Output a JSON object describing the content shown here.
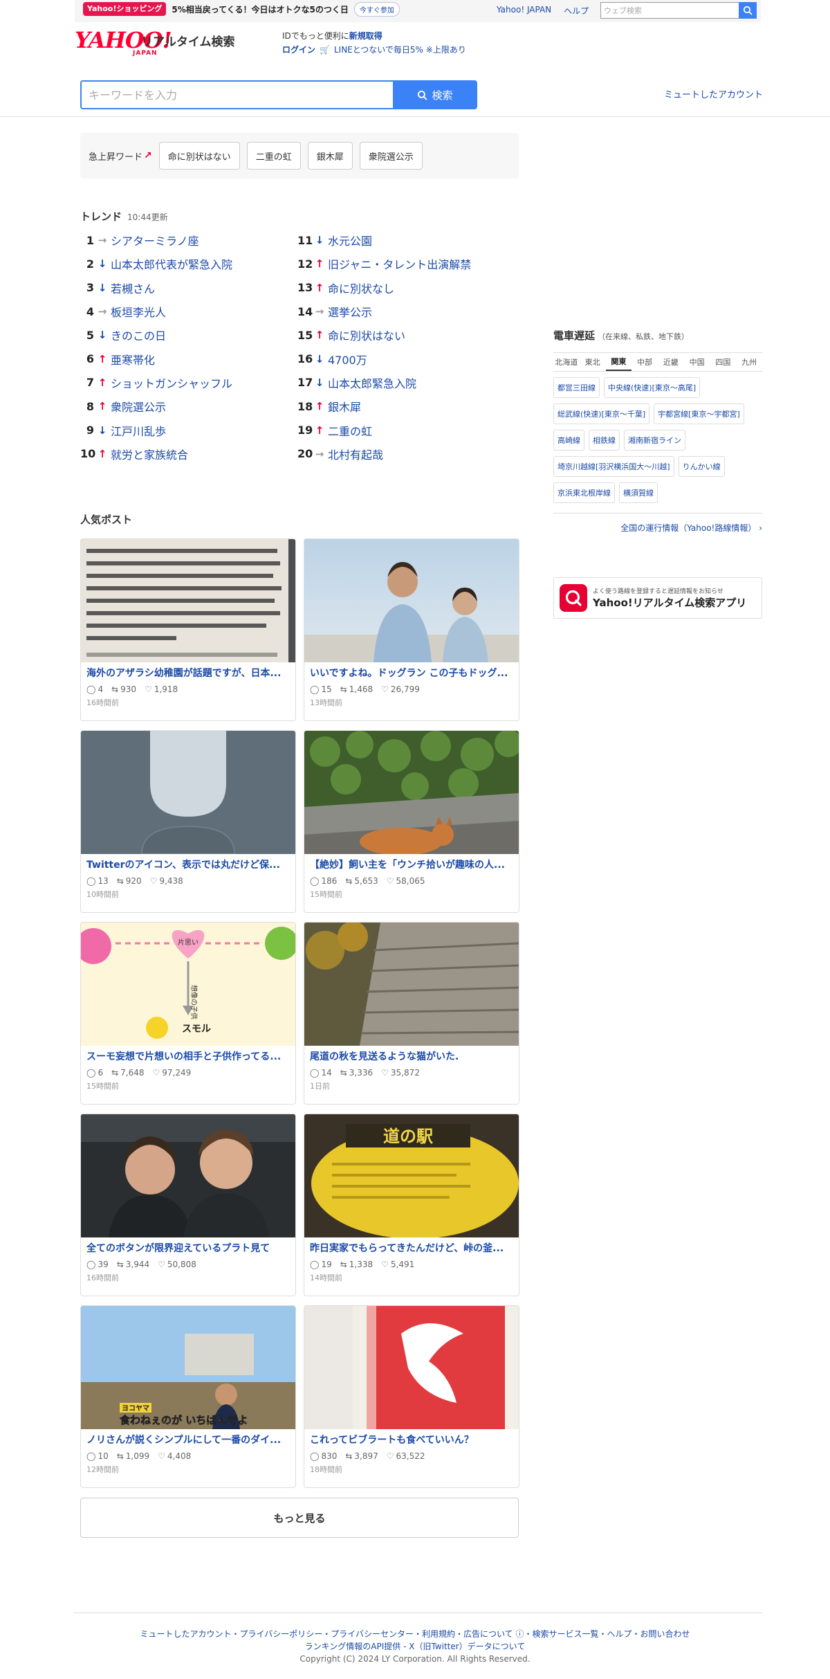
{
  "topbar": {
    "promo_badge": "Yahoo!ショッピング",
    "promo_text": "5%相当戻ってくる！今日はオトクな5のつく日",
    "promo_join": "今すぐ参加",
    "links": [
      "Yahoo! JAPAN",
      "ヘルプ"
    ],
    "web_search_placeholder": "ウェブ検索"
  },
  "header": {
    "logo_yahoo": "YAHOO!",
    "logo_japan": "JAPAN",
    "logo_service": "リアルタイム検索",
    "id_text_prefix": "IDでもっと便利に",
    "id_text_link": "新規取得",
    "login": "ログイン",
    "line_promo": "LINEとつないで毎日5% ※上限あり"
  },
  "search": {
    "placeholder": "キーワードを入力",
    "button": "検索",
    "muted_accounts": "ミュートしたアカウント"
  },
  "rising": {
    "label": "急上昇ワード",
    "words": [
      "命に別状はない",
      "二重の虹",
      "銀木犀",
      "衆院選公示"
    ]
  },
  "trend": {
    "title": "トレンド",
    "updated": "10:44更新",
    "items": [
      {
        "rank": "1",
        "dir": "flat",
        "word": "シアターミラノ座"
      },
      {
        "rank": "2",
        "dir": "down",
        "word": "山本太郎代表が緊急入院"
      },
      {
        "rank": "3",
        "dir": "down",
        "word": "若槻さん"
      },
      {
        "rank": "4",
        "dir": "flat",
        "word": "板垣李光人"
      },
      {
        "rank": "5",
        "dir": "down",
        "word": "きのこの日"
      },
      {
        "rank": "6",
        "dir": "up",
        "word": "亜寒帯化"
      },
      {
        "rank": "7",
        "dir": "up",
        "word": "ショットガンシャッフル"
      },
      {
        "rank": "8",
        "dir": "up",
        "word": "衆院選公示"
      },
      {
        "rank": "9",
        "dir": "down",
        "word": "江戸川乱歩"
      },
      {
        "rank": "10",
        "dir": "up",
        "word": "就労と家族統合"
      },
      {
        "rank": "11",
        "dir": "down",
        "word": "水元公園"
      },
      {
        "rank": "12",
        "dir": "up",
        "word": "旧ジャニ・タレント出演解禁"
      },
      {
        "rank": "13",
        "dir": "up",
        "word": "命に別状なし"
      },
      {
        "rank": "14",
        "dir": "flat",
        "word": "選挙公示"
      },
      {
        "rank": "15",
        "dir": "up",
        "word": "命に別状はない"
      },
      {
        "rank": "16",
        "dir": "down",
        "word": "4700万"
      },
      {
        "rank": "17",
        "dir": "down",
        "word": "山本太郎緊急入院"
      },
      {
        "rank": "18",
        "dir": "up",
        "word": "銀木犀"
      },
      {
        "rank": "19",
        "dir": "up",
        "word": "二重の虹"
      },
      {
        "rank": "20",
        "dir": "flat",
        "word": "北村有起哉"
      }
    ]
  },
  "posts": {
    "title": "人気ポスト",
    "items": [
      {
        "title": "海外のアザラシ幼稚園が話題ですが、日本...",
        "replies": "4",
        "reposts": "930",
        "likes": "1,918",
        "time": "16時間前",
        "image": "document-photo"
      },
      {
        "title": "いいですよね。ドッグラン この子もドッグ...",
        "replies": "15",
        "reposts": "1,468",
        "likes": "26,799",
        "time": "13時間前",
        "image": "couple-photo"
      },
      {
        "title": "Twitterのアイコン、表示では丸だけど保...",
        "replies": "13",
        "reposts": "920",
        "likes": "9,438",
        "time": "10時間前",
        "image": "default-avatar"
      },
      {
        "title": "【絶妙】飼い主を「ウンチ拾いが趣味の人...",
        "replies": "186",
        "reposts": "5,653",
        "likes": "58,065",
        "time": "15時間前",
        "image": "shiba-dog"
      },
      {
        "title": "スーモ妄想で片想いの相手と子供作ってる...",
        "replies": "6",
        "reposts": "7,648",
        "likes": "97,249",
        "time": "15時間前",
        "image": "suumo-illustration"
      },
      {
        "title": "尾道の秋を見送るような猫がいた.",
        "replies": "14",
        "reposts": "3,336",
        "likes": "35,872",
        "time": "1日前",
        "image": "stone-steps"
      },
      {
        "title": "全てのボタンが限界迎えているプラト見て",
        "replies": "39",
        "reposts": "3,944",
        "likes": "50,808",
        "time": "16時間前",
        "image": "two-men"
      },
      {
        "title": "昨日実家でもらってきたんだけど、峠の釜...",
        "replies": "19",
        "reposts": "1,338",
        "likes": "5,491",
        "time": "14時間前",
        "image": "yellow-package"
      },
      {
        "title": "ノリさんが説くシンプルにして一番のダイ...",
        "replies": "10",
        "reposts": "1,099",
        "likes": "4,408",
        "time": "12時間前",
        "image": "tv-screen"
      },
      {
        "title": "これってビブラートも食べていいん？",
        "replies": "830",
        "reposts": "3,897",
        "likes": "63,522",
        "time": "18時間前",
        "image": "snack-bag"
      }
    ],
    "overlay_texts": {
      "suumo_kataomoi": "片思い",
      "suumo_child": "想像の子供",
      "suumo_name": "スモル",
      "tv_caption_small": "ヨコヤマ",
      "tv_caption": "食わねぇのが いちばんだよ",
      "package_text": "道の駅"
    },
    "more": "もっと見る"
  },
  "train": {
    "title": "電車遅延",
    "subtitle": "（在来線、私鉄、地下鉄）",
    "regions": [
      "北海道",
      "東北",
      "関東",
      "中部",
      "近畿",
      "中国",
      "四国",
      "九州"
    ],
    "active_region": "関東",
    "lines": [
      "都営三田線",
      "中央線(快速)[東京～高尾]",
      "総武線(快速)[東京～千葉]",
      "宇都宮線[東京～宇都宮]",
      "高崎線",
      "相鉄線",
      "湘南新宿ライン",
      "埼京川越線[羽沢横浜国大～川越]",
      "りんかい線",
      "京浜東北根岸線",
      "横須賀線"
    ],
    "more": "全国の運行情報（Yahoo!路線情報）",
    "app_sub": "よく使う路線を登録すると遅延情報をお知らせ",
    "app_name": "Yahoo!リアルタイム検索アプリ"
  },
  "footer": {
    "links": "ミュートしたアカウント・プライバシーポリシー・プライバシーセンター・利用規約・広告について ⓘ・検索サービス一覧・ヘルプ・お問い合わせ",
    "api": "ランキング情報のAPI提供 - X（旧Twitter）データについて",
    "copyright": "Copyright (C) 2024 LY Corporation. All Rights Reserved."
  },
  "colors": {
    "brand_red": "#ff0033",
    "link_blue": "#1b4aa7",
    "accent_blue": "#3b82f6",
    "up_red": "#e60033"
  }
}
